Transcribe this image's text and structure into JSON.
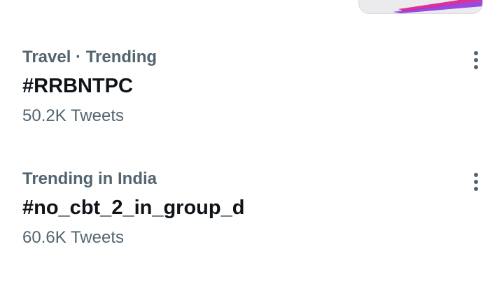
{
  "trends": [
    {
      "context": "Travel · Trending",
      "name": "#RRBNTPC",
      "count": "50.2K Tweets",
      "more_icon": "more-vertical-icon"
    },
    {
      "context": "Trending in India",
      "name": "#no_cbt_2_in_group_d",
      "count": "60.6K Tweets",
      "more_icon": "more-vertical-icon"
    }
  ],
  "colors": {
    "primary_text": "#0f1419",
    "secondary_text": "#536471",
    "background": "#ffffff"
  }
}
